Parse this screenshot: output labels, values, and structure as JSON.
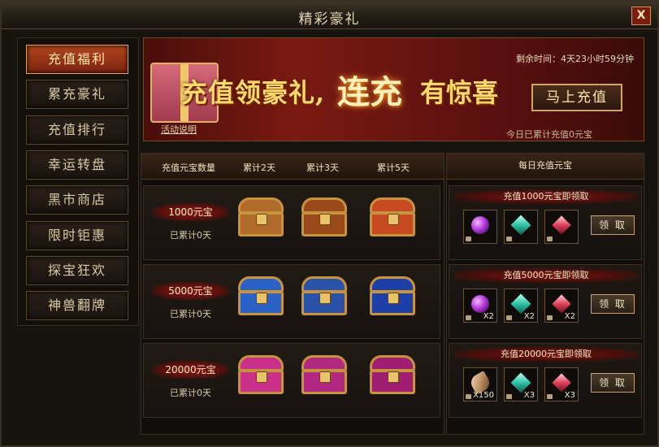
{
  "window": {
    "title": "精彩豪礼",
    "close_label": "X"
  },
  "sidebar": {
    "items": [
      {
        "label": "充值福利",
        "active": true
      },
      {
        "label": "累充豪礼"
      },
      {
        "label": "充值排行"
      },
      {
        "label": "幸运转盘"
      },
      {
        "label": "黑市商店"
      },
      {
        "label": "限时钜惠"
      },
      {
        "label": "探宝狂欢"
      },
      {
        "label": "神兽翻牌"
      }
    ]
  },
  "banner": {
    "slogan_part1": "充值领豪礼,",
    "slogan_part2": "连充",
    "slogan_part3": "有惊喜",
    "remaining_time": "剩余时间：4天23小时59分钟",
    "recharge_button": "马上充值",
    "event_link": "活动说明",
    "today_total": "今日已累计充值0元宝"
  },
  "left_table": {
    "headers": [
      "充值元宝数量",
      "累计2天",
      "累计3天",
      "累计5天"
    ],
    "tiers": [
      {
        "amount": "1000元宝",
        "days": "已累计0天",
        "chest_color": "#b06a2a",
        "chest_color2": "#c84a22"
      },
      {
        "amount": "5000元宝",
        "days": "已累计0天",
        "chest_color": "#2a62c8",
        "chest_color2": "#1e3ea8"
      },
      {
        "amount": "20000元宝",
        "days": "已累计0天",
        "chest_color": "#c8308a",
        "chest_color2": "#a01e70"
      }
    ]
  },
  "right_panel": {
    "header": "每日充值元宝",
    "tiers": [
      {
        "title": "充值1000元宝即领取",
        "items": [
          {
            "icon": "purple-orb-icon",
            "qty": ""
          },
          {
            "icon": "teal-crystal-icon",
            "qty": ""
          },
          {
            "icon": "pink-crystal-icon",
            "qty": ""
          }
        ],
        "claim_label": "领 取"
      },
      {
        "title": "充值5000元宝即领取",
        "items": [
          {
            "icon": "purple-orb-icon",
            "qty": "X2"
          },
          {
            "icon": "teal-crystal-icon",
            "qty": "X2"
          },
          {
            "icon": "pink-crystal-icon",
            "qty": "X2"
          }
        ],
        "claim_label": "领 取"
      },
      {
        "title": "充值20000元宝即领取",
        "items": [
          {
            "icon": "feather-icon",
            "qty": "X150"
          },
          {
            "icon": "teal-crystal-icon",
            "qty": "X3"
          },
          {
            "icon": "pink-crystal-icon",
            "qty": "X3"
          }
        ],
        "claim_label": "领 取"
      }
    ]
  }
}
